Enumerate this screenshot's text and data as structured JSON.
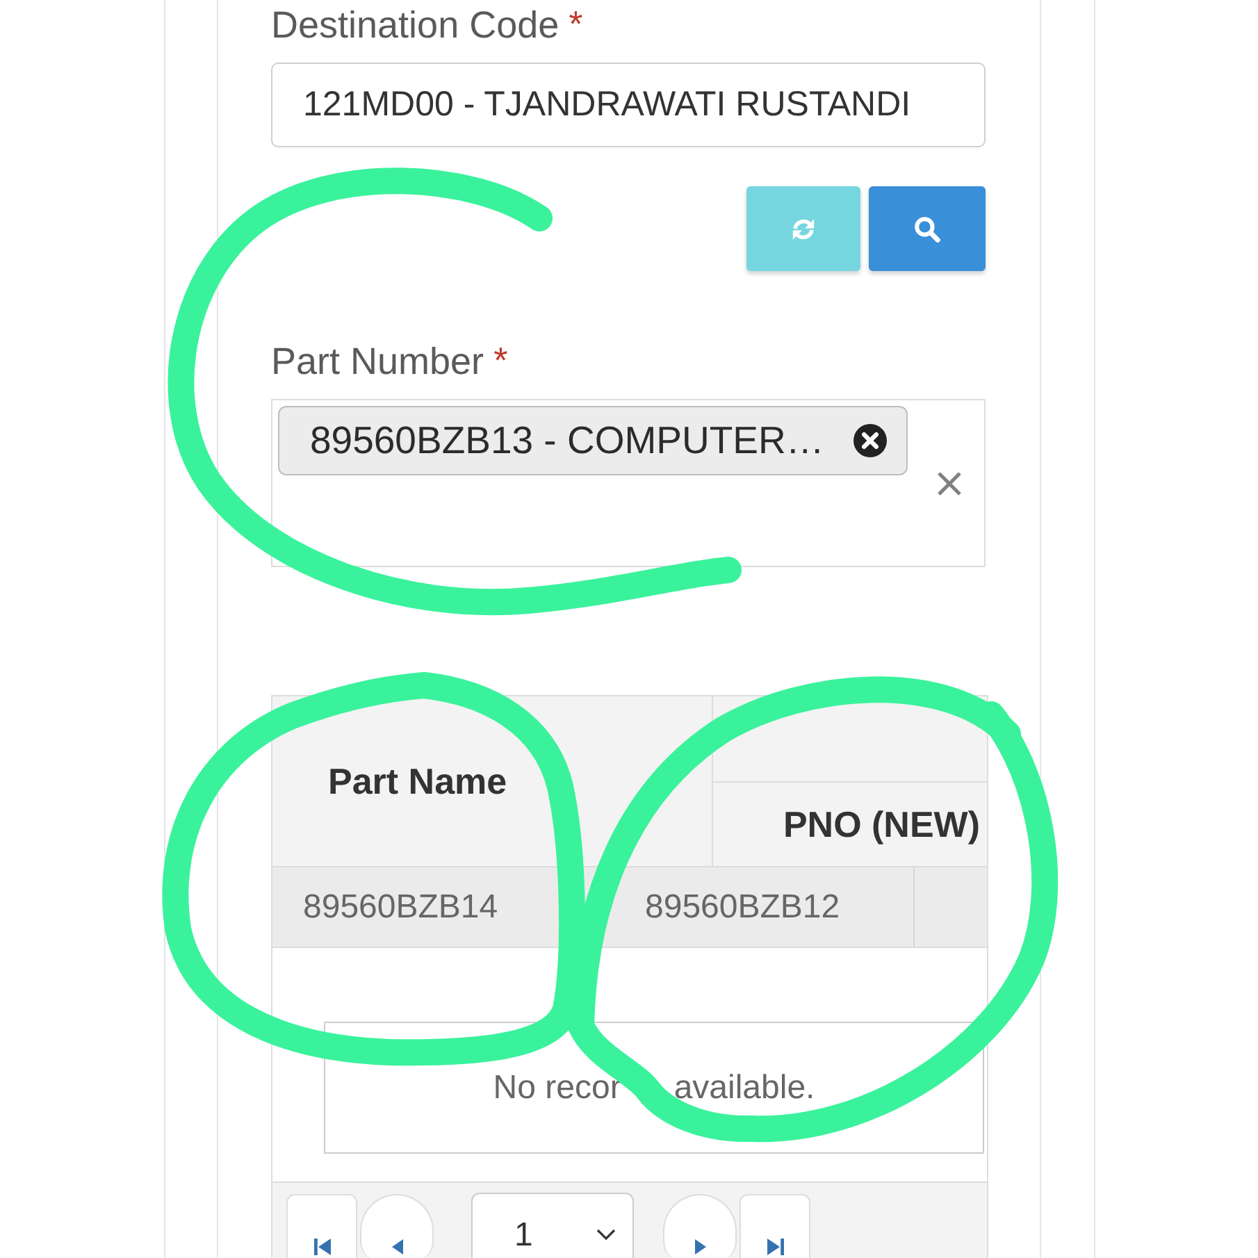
{
  "destination_code": {
    "label": "Destination Code",
    "required_mark": "*",
    "value": "121MD00 - TJANDRAWATI RUSTANDI"
  },
  "actions": [
    {
      "kind": "refresh"
    },
    {
      "kind": "search"
    }
  ],
  "part_number": {
    "label": "Part Number",
    "required_mark": "*",
    "tags": [
      "89560BZB13 - COMPUTER…"
    ]
  },
  "table": {
    "columns": [
      "Part Name",
      "PNO (NEW)"
    ],
    "rows": [
      [
        "89560BZB14",
        "89560BZB12"
      ]
    ],
    "empty_message_visible": [
      "No recor",
      "available."
    ]
  },
  "pager": {
    "page": "1"
  }
}
